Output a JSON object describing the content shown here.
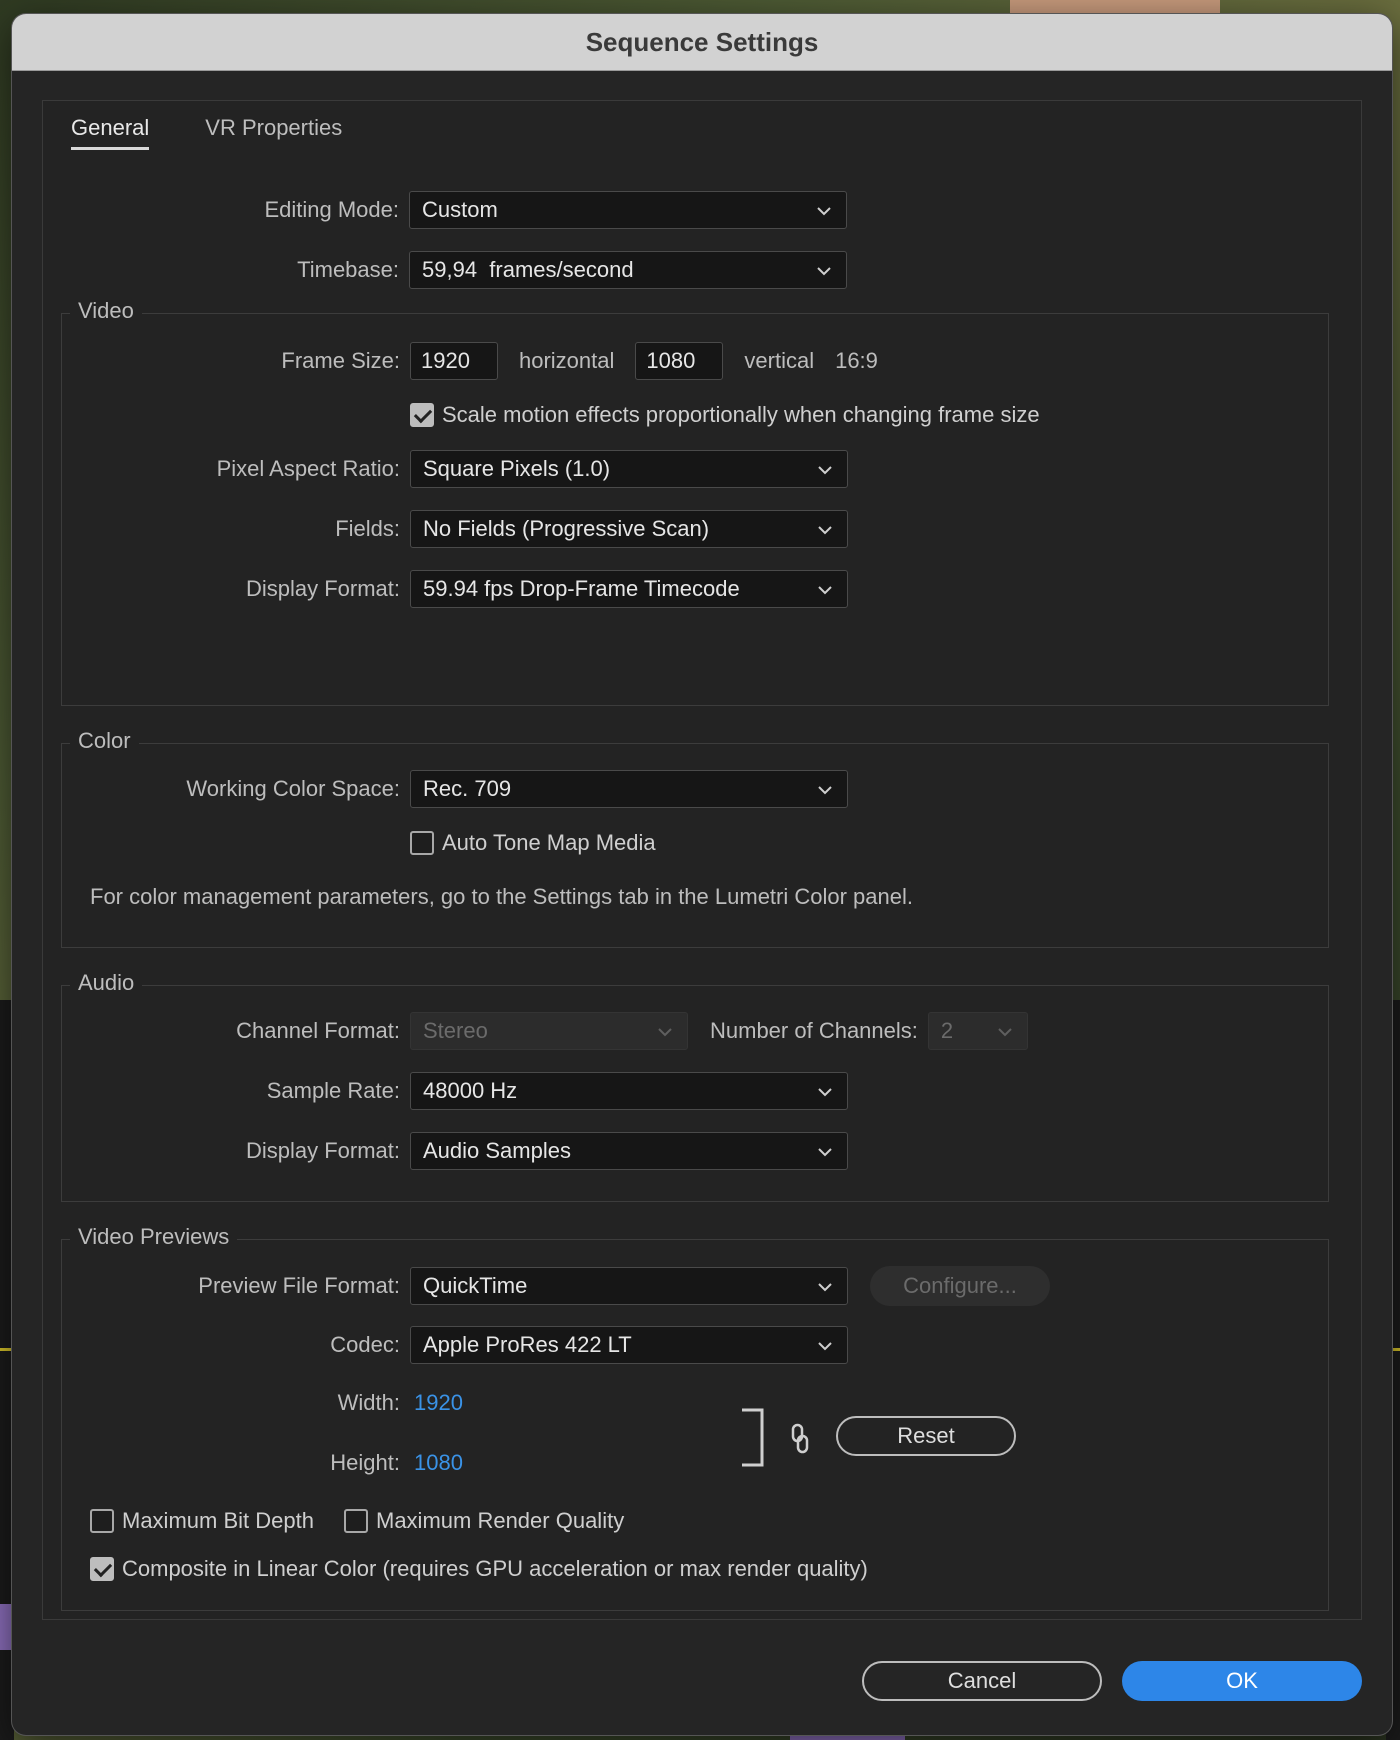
{
  "dialog": {
    "title": "Sequence Settings"
  },
  "tabs": [
    {
      "label": "General",
      "active": true
    },
    {
      "label": "VR Properties",
      "active": false
    }
  ],
  "general": {
    "editing_mode_label": "Editing Mode:",
    "editing_mode_value": "Custom",
    "timebase_label": "Timebase:",
    "timebase_value": "59,94  frames/second"
  },
  "video": {
    "title": "Video",
    "frame_size_label": "Frame Size:",
    "frame_width": "1920",
    "horizontal_label": "horizontal",
    "frame_height": "1080",
    "vertical_label": "vertical",
    "aspect": "16:9",
    "scale_motion_label": "Scale motion effects proportionally when changing frame size",
    "scale_motion_checked": true,
    "pixel_aspect_label": "Pixel Aspect Ratio:",
    "pixel_aspect_value": "Square Pixels (1.0)",
    "fields_label": "Fields:",
    "fields_value": "No Fields (Progressive Scan)",
    "display_format_label": "Display Format:",
    "display_format_value": "59.94 fps Drop-Frame Timecode"
  },
  "color": {
    "title": "Color",
    "working_space_label": "Working Color Space:",
    "working_space_value": "Rec. 709",
    "auto_tone_label": "Auto Tone Map Media",
    "auto_tone_checked": false,
    "note": "For color management parameters, go to the Settings tab in the Lumetri Color panel."
  },
  "audio": {
    "title": "Audio",
    "channel_format_label": "Channel Format:",
    "channel_format_value": "Stereo",
    "num_channels_label": "Number of Channels:",
    "num_channels_value": "2",
    "sample_rate_label": "Sample Rate:",
    "sample_rate_value": "48000 Hz",
    "display_format_label": "Display Format:",
    "display_format_value": "Audio Samples"
  },
  "previews": {
    "title": "Video Previews",
    "file_format_label": "Preview File Format:",
    "file_format_value": "QuickTime",
    "configure_label": "Configure...",
    "codec_label": "Codec:",
    "codec_value": "Apple ProRes 422 LT",
    "width_label": "Width:",
    "width_value": "1920",
    "height_label": "Height:",
    "height_value": "1080",
    "reset_label": "Reset",
    "max_bit_depth_label": "Maximum Bit Depth",
    "max_bit_depth_checked": false,
    "max_render_label": "Maximum Render Quality",
    "max_render_checked": false,
    "linear_color_label": "Composite in Linear Color (requires GPU acceleration or max render quality)",
    "linear_color_checked": true
  },
  "footer": {
    "cancel_label": "Cancel",
    "ok_label": "OK"
  },
  "colors": {
    "accent": "#2d86e8",
    "value_blue": "#3a92e6",
    "dialog_bg": "#252525",
    "titlebar_bg": "#d2d2d2"
  },
  "icons": {
    "dropdown": "chevron-down-icon",
    "link": "link-icon",
    "bracket": "bracket-icon"
  }
}
